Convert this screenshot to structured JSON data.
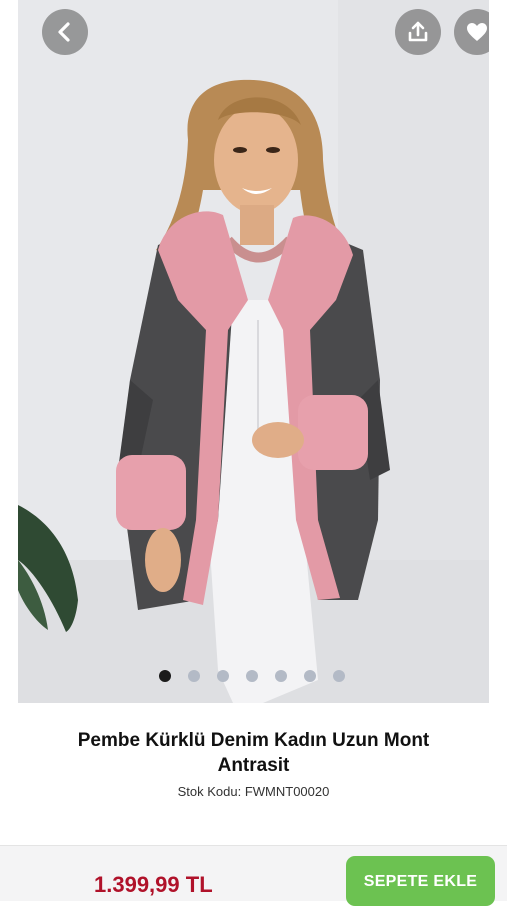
{
  "product": {
    "title": "Pembe Kürklü Denim Kadın Uzun Mont Antrasit",
    "sku_label": "Stok Kodu: FWMNT00020",
    "price": "1.399,99 TL",
    "add_to_cart_label": "SEPETE EKLE"
  },
  "gallery": {
    "image_count": 7,
    "active_index": 0
  },
  "colors": {
    "price": "#b0122a",
    "cart_button": "#6cc251",
    "active_dot": "#1b1b1b",
    "inactive_dot": "#b3bac6",
    "overlay_button": "#7a7a7a"
  },
  "icons": {
    "back": "chevron-left-icon",
    "share": "share-upload-icon",
    "favorite": "heart-icon"
  }
}
